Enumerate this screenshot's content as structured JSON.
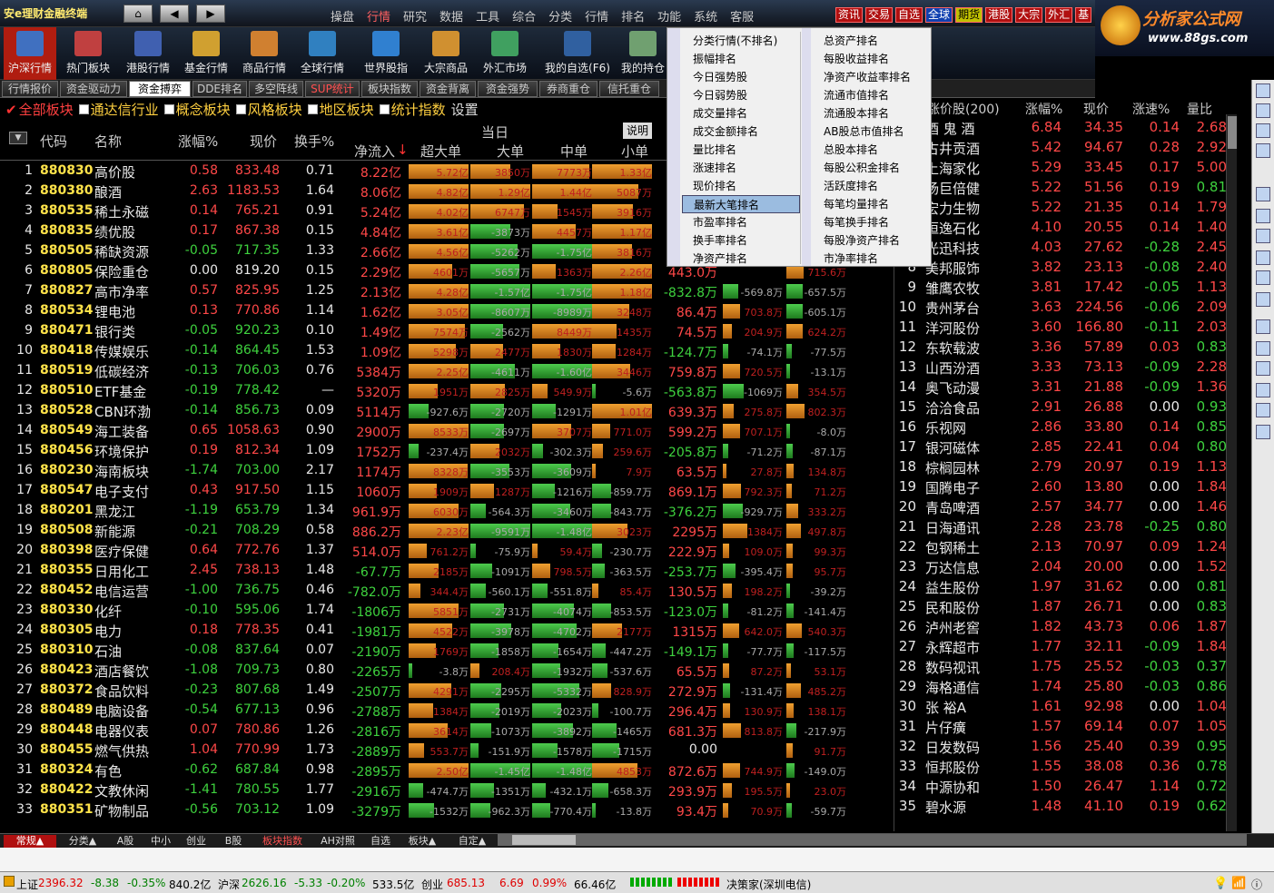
{
  "brand": "安e理财金融终端",
  "top_menu": [
    "操盘",
    "行情",
    "研究",
    "数据",
    "工具",
    "综合",
    "分类",
    "行情",
    "排名",
    "功能",
    "系统",
    "客服"
  ],
  "quick_buttons": [
    "资讯",
    "交易",
    "自选",
    "全球",
    "期货",
    "港股",
    "大宗",
    "外汇",
    "基"
  ],
  "logo": {
    "title": "分析家公式网",
    "url": "www.88gs.com"
  },
  "toolbar": [
    "沪深行情",
    "热门板块",
    "港股行情",
    "基金行情",
    "商品行情",
    "全球行情",
    "世界股指",
    "大宗商品",
    "外汇市场",
    "我的自选(F6)",
    "我的持仓"
  ],
  "tabs": [
    "行情报价",
    "资金驱动力",
    "资金搏弈",
    "DDE排名",
    "多空阵线",
    "SUP统计",
    "板块指数",
    "资金背离",
    "资金强势",
    "券商重仓",
    "信托重仓"
  ],
  "filter": [
    "全部板块",
    "通达信行业",
    "概念板块",
    "风格板块",
    "地区板块",
    "统计指数",
    "设置"
  ],
  "left_head": {
    "code": "代码",
    "name": "名称",
    "pct": "涨幅%",
    "price": "现价",
    "turnover": "换手%",
    "today": "当日",
    "net": "净流入",
    "big": "超大单",
    "large": "大单",
    "mid": "中单",
    "small": "小单",
    "explain": "说明"
  },
  "rows": [
    [
      "1",
      "880830",
      "高价股",
      "0.58",
      "833.48",
      "0.71",
      "8.22亿",
      "5.72亿",
      "3850万",
      "7773万",
      "1.33亿"
    ],
    [
      "2",
      "880380",
      "酿酒",
      "2.63",
      "1183.53",
      "1.64",
      "8.06亿",
      "4.82亿",
      "1.29亿",
      "1.44亿",
      "5087万"
    ],
    [
      "3",
      "880535",
      "稀土永磁",
      "0.14",
      "765.21",
      "0.91",
      "5.24亿",
      "4.02亿",
      "6747万",
      "1545万",
      "3916万"
    ],
    [
      "4",
      "880835",
      "绩优股",
      "0.17",
      "867.38",
      "0.15",
      "4.84亿",
      "3.61亿",
      "-3873万",
      "4457万",
      "1.17亿"
    ],
    [
      "5",
      "880505",
      "稀缺资源",
      "-0.05",
      "717.35",
      "1.33",
      "2.66亿",
      "4.56亿",
      "-5262万",
      "-1.75亿",
      "3816万"
    ],
    [
      "6",
      "880805",
      "保险重仓",
      "0.00",
      "819.20",
      "0.15",
      "2.29亿",
      "4601万",
      "-5657万",
      "1363万",
      "2.26亿"
    ],
    [
      "7",
      "880827",
      "高市净率",
      "0.57",
      "825.95",
      "1.25",
      "2.13亿",
      "4.28亿",
      "-1.57亿",
      "-1.75亿",
      "1.18亿"
    ],
    [
      "8",
      "880534",
      "锂电池",
      "0.13",
      "770.86",
      "1.14",
      "1.62亿",
      "3.05亿",
      "-8607万",
      "-8989万",
      "3248万"
    ],
    [
      "9",
      "880471",
      "银行类",
      "-0.05",
      "920.23",
      "0.10",
      "1.49亿",
      "7574万",
      "-2562万",
      "8449万",
      "1435万"
    ],
    [
      "10",
      "880418",
      "传媒娱乐",
      "-0.14",
      "864.45",
      "1.53",
      "1.09亿",
      "5298万",
      "2477万",
      "1830万",
      "1284万"
    ],
    [
      "11",
      "880519",
      "低碳经济",
      "-0.13",
      "706.03",
      "0.76",
      "5384万",
      "2.25亿",
      "-4611万",
      "-1.60亿",
      "3446万"
    ],
    [
      "12",
      "880510",
      "ETF基金",
      "-0.19",
      "778.42",
      "—",
      "5320万",
      "1951万",
      "2825万",
      "549.9万",
      "-5.6万"
    ],
    [
      "13",
      "880528",
      "CBN环渤",
      "-0.14",
      "856.73",
      "0.09",
      "5114万",
      "-927.6万",
      "-2720万",
      "-1291万",
      "1.01亿"
    ],
    [
      "14",
      "880549",
      "海工装备",
      "0.65",
      "1058.63",
      "0.90",
      "2900万",
      "8533万",
      "-2697万",
      "3707万",
      "771.0万"
    ],
    [
      "15",
      "880456",
      "环境保护",
      "0.19",
      "812.34",
      "1.09",
      "1752万",
      "-237.4万",
      "2032万",
      "-302.3万",
      "259.6万"
    ],
    [
      "16",
      "880230",
      "海南板块",
      "-1.74",
      "703.00",
      "2.17",
      "1174万",
      "8328万",
      "-3553万",
      "-3609万",
      "7.9万"
    ],
    [
      "17",
      "880547",
      "电子支付",
      "0.43",
      "917.50",
      "1.15",
      "1060万",
      "1909万",
      "1287万",
      "-1216万",
      "-859.7万"
    ],
    [
      "18",
      "880201",
      "黑龙江",
      "-1.19",
      "653.79",
      "1.34",
      "961.9万",
      "6030万",
      "-564.3万",
      "-3460万",
      "-843.7万"
    ],
    [
      "19",
      "880508",
      "新能源",
      "-0.21",
      "708.29",
      "0.58",
      "886.2万",
      "2.23亿",
      "-9591万",
      "-1.48亿",
      "3023万"
    ],
    [
      "20",
      "880398",
      "医疗保健",
      "0.64",
      "772.76",
      "1.37",
      "514.0万",
      "761.2万",
      "-75.9万",
      "59.4万",
      "-230.7万"
    ],
    [
      "21",
      "880355",
      "日用化工",
      "2.45",
      "738.13",
      "1.48",
      "-67.7万",
      "2185万",
      "-1091万",
      "798.5万",
      "-363.5万"
    ],
    [
      "22",
      "880452",
      "电信运营",
      "-1.00",
      "736.75",
      "0.46",
      "-782.0万",
      "344.4万",
      "-560.1万",
      "-551.8万",
      "85.4万"
    ],
    [
      "23",
      "880330",
      "化纤",
      "-0.10",
      "595.06",
      "1.74",
      "-1806万",
      "5851万",
      "-2731万",
      "-4074万",
      "-853.5万"
    ],
    [
      "24",
      "880305",
      "电力",
      "0.18",
      "778.35",
      "0.41",
      "-1981万",
      "4522万",
      "-3978万",
      "-4702万",
      "2177万"
    ],
    [
      "25",
      "880310",
      "石油",
      "-0.08",
      "837.64",
      "0.07",
      "-2190万",
      "1769万",
      "-1858万",
      "-1654万",
      "-447.2万"
    ],
    [
      "26",
      "880423",
      "酒店餐饮",
      "-1.08",
      "709.73",
      "0.80",
      "-2265万",
      "-3.8万",
      "208.4万",
      "-1932万",
      "-537.6万"
    ],
    [
      "27",
      "880372",
      "食品饮料",
      "-0.23",
      "807.68",
      "1.49",
      "-2507万",
      "4291万",
      "-2295万",
      "-5332万",
      "828.9万"
    ],
    [
      "28",
      "880489",
      "电脑设备",
      "-0.54",
      "677.13",
      "0.96",
      "-2788万",
      "1384万",
      "-2019万",
      "-2023万",
      "-100.7万"
    ],
    [
      "29",
      "880448",
      "电器仪表",
      "0.07",
      "780.86",
      "1.26",
      "-2816万",
      "3614万",
      "-1073万",
      "-3892万",
      "-1465万"
    ],
    [
      "30",
      "880455",
      "燃气供热",
      "1.04",
      "770.99",
      "1.73",
      "-2889万",
      "553.7万",
      "-151.9万",
      "-1578万",
      "-1715万"
    ],
    [
      "31",
      "880324",
      "有色",
      "-0.62",
      "687.84",
      "0.98",
      "-2895万",
      "2.50亿",
      "-1.45亿",
      "-1.48亿",
      "4853万"
    ],
    [
      "32",
      "880422",
      "文教休闲",
      "-1.41",
      "780.55",
      "1.77",
      "-2916万",
      "-474.7万",
      "-1351万",
      "-432.1万",
      "-658.3万"
    ],
    [
      "33",
      "880351",
      "矿物制品",
      "-0.56",
      "703.12",
      "1.09",
      "-3279万",
      "-1532万",
      "-962.3万",
      "-770.4万",
      "-13.8万"
    ]
  ],
  "extra_cols": [
    [
      "",
      "",
      "",
      "",
      ""
    ],
    [
      "",
      "",
      "",
      "",
      ""
    ],
    [
      "",
      "",
      "",
      "",
      ""
    ],
    [
      "",
      "",
      "",
      "",
      ""
    ],
    [
      "",
      "",
      "",
      "",
      ""
    ],
    [
      "443.0万",
      "",
      "715.6万",
      "",
      ""
    ],
    [
      "-832.8万",
      "-569.8万",
      "-657.5万",
      "",
      ""
    ],
    [
      "86.4万",
      "703.8万",
      "-605.1万",
      "",
      ""
    ],
    [
      "74.5万",
      "204.9万",
      "624.2万",
      "",
      ""
    ],
    [
      "-124.7万",
      "-74.1万",
      "-77.5万",
      "",
      ""
    ],
    [
      "759.8万",
      "720.5万",
      "-13.1万",
      "",
      ""
    ],
    [
      "-563.8万",
      "-1069万",
      "354.5万",
      "",
      ""
    ],
    [
      "639.3万",
      "275.8万",
      "802.3万",
      "",
      ""
    ],
    [
      "599.2万",
      "707.1万",
      "-8.0万",
      "",
      ""
    ],
    [
      "-205.8万",
      "-71.2万",
      "-87.1万",
      "",
      ""
    ],
    [
      "63.5万",
      "27.8万",
      "134.8万",
      "",
      ""
    ],
    [
      "869.1万",
      "792.3万",
      "71.2万",
      "",
      ""
    ],
    [
      "-376.2万",
      "-929.7万",
      "333.2万",
      "",
      ""
    ],
    [
      "2295万",
      "1384万",
      "497.8万",
      "",
      ""
    ],
    [
      "222.9万",
      "109.0万",
      "99.3万",
      "",
      ""
    ],
    [
      "-253.7万",
      "-395.4万",
      "95.7万",
      "",
      ""
    ],
    [
      "130.5万",
      "198.2万",
      "-39.2万",
      "",
      ""
    ],
    [
      "-123.0万",
      "-81.2万",
      "-141.4万",
      "",
      ""
    ],
    [
      "1315万",
      "642.0万",
      "540.3万",
      "",
      ""
    ],
    [
      "-149.1万",
      "-77.7万",
      "-117.5万",
      "",
      ""
    ],
    [
      "65.5万",
      "87.2万",
      "53.1万",
      "",
      ""
    ],
    [
      "272.9万",
      "-131.4万",
      "485.2万",
      "",
      ""
    ],
    [
      "296.4万",
      "130.9万",
      "138.1万",
      "",
      ""
    ],
    [
      "681.3万",
      "813.8万",
      "-217.9万",
      "",
      ""
    ],
    [
      "0.00",
      "",
      "91.7万",
      "",
      ""
    ],
    [
      "872.6万",
      "744.9万",
      "-149.0万",
      "",
      ""
    ],
    [
      "293.9万",
      "195.5万",
      "23.0万",
      "",
      ""
    ],
    [
      "93.4万",
      "70.9万",
      "-59.7万",
      "",
      ""
    ]
  ],
  "dropdown": {
    "col1": [
      "分类行情(不排名)",
      "振幅排名",
      "今日强势股",
      "今日弱势股",
      "成交量排名",
      "成交金额排名",
      "量比排名",
      "涨速排名",
      "现价排名",
      "最新大笔排名",
      "市盈率排名",
      "换手率排名",
      "净资产排名"
    ],
    "col2": [
      "总资产排名",
      "每股收益排名",
      "净资产收益率排名",
      "流通市值排名",
      "流通股本排名",
      "AB股总市值排名",
      "总股本排名",
      "每股公积金排名",
      "活跃度排名",
      "每笔均量排名",
      "每笔换手排名",
      "每股净资产排名",
      "市净率排名"
    ],
    "highlight": "最新大笔排名"
  },
  "right_head": {
    "name": "涨价股(200)",
    "pct": "涨幅%",
    "price": "现价",
    "speed": "涨速%",
    "vr": "量比"
  },
  "right_rows": [
    [
      "1",
      "酒 鬼 酒",
      "6.84",
      "34.35",
      "0.14",
      "2.68"
    ],
    [
      "2",
      "古井贡酒",
      "5.42",
      "94.67",
      "0.28",
      "2.92"
    ],
    [
      "3",
      "上海家化",
      "5.29",
      "33.45",
      "0.17",
      "5.00"
    ],
    [
      "4",
      "扬巨倍健",
      "5.22",
      "51.56",
      "0.19",
      "0.81"
    ],
    [
      "5",
      "宏力生物",
      "5.22",
      "21.35",
      "0.14",
      "1.79"
    ],
    [
      "6",
      "恒逸石化",
      "4.10",
      "20.55",
      "0.14",
      "1.40"
    ],
    [
      "7",
      "光迅科技",
      "4.03",
      "27.62",
      "-0.28",
      "2.45"
    ],
    [
      "8",
      "美邦服饰",
      "3.82",
      "23.13",
      "-0.08",
      "2.40"
    ],
    [
      "9",
      "雏鹰农牧",
      "3.81",
      "17.42",
      "-0.05",
      "1.13"
    ],
    [
      "10",
      "贵州茅台",
      "3.63",
      "224.56",
      "-0.06",
      "2.09"
    ],
    [
      "11",
      "洋河股份",
      "3.60",
      "166.80",
      "-0.11",
      "2.03"
    ],
    [
      "12",
      "东软载波",
      "3.36",
      "57.89",
      "0.03",
      "0.83"
    ],
    [
      "13",
      "山西汾酒",
      "3.33",
      "73.13",
      "-0.09",
      "2.28"
    ],
    [
      "14",
      "奥飞动漫",
      "3.31",
      "21.88",
      "-0.09",
      "1.36"
    ],
    [
      "15",
      "洽洽食品",
      "2.91",
      "26.88",
      "0.00",
      "0.93"
    ],
    [
      "16",
      "乐视网",
      "2.86",
      "33.80",
      "0.14",
      "0.85"
    ],
    [
      "17",
      "银河磁体",
      "2.85",
      "22.41",
      "0.04",
      "0.80"
    ],
    [
      "18",
      "棕榈园林",
      "2.79",
      "20.97",
      "0.19",
      "1.13"
    ],
    [
      "19",
      "国腾电子",
      "2.60",
      "13.80",
      "0.00",
      "1.84"
    ],
    [
      "20",
      "青岛啤酒",
      "2.57",
      "34.77",
      "0.00",
      "1.46"
    ],
    [
      "21",
      "日海通讯",
      "2.28",
      "23.78",
      "-0.25",
      "0.80"
    ],
    [
      "22",
      "包钢稀土",
      "2.13",
      "70.97",
      "0.09",
      "1.24"
    ],
    [
      "23",
      "万达信息",
      "2.04",
      "20.00",
      "0.00",
      "1.52"
    ],
    [
      "24",
      "益生股份",
      "1.97",
      "31.62",
      "0.00",
      "0.81"
    ],
    [
      "25",
      "民和股份",
      "1.87",
      "26.71",
      "0.00",
      "0.83"
    ],
    [
      "26",
      "泸州老窖",
      "1.82",
      "43.73",
      "0.06",
      "1.87"
    ],
    [
      "27",
      "永辉超市",
      "1.77",
      "32.11",
      "-0.09",
      "1.84"
    ],
    [
      "28",
      "数码视讯",
      "1.75",
      "25.52",
      "-0.03",
      "0.37"
    ],
    [
      "29",
      "海格通信",
      "1.74",
      "25.80",
      "-0.03",
      "0.86"
    ],
    [
      "30",
      "张  裕A",
      "1.61",
      "92.98",
      "0.00",
      "1.04"
    ],
    [
      "31",
      "片仔癀",
      "1.57",
      "69.14",
      "0.07",
      "1.05"
    ],
    [
      "32",
      "日发数码",
      "1.56",
      "25.40",
      "0.39",
      "0.95"
    ],
    [
      "33",
      "恒邦股份",
      "1.55",
      "38.08",
      "0.36",
      "0.78"
    ],
    [
      "34",
      "中源协和",
      "1.50",
      "26.47",
      "1.14",
      "0.72"
    ],
    [
      "35",
      "碧水源",
      "1.48",
      "41.10",
      "0.19",
      "0.62"
    ]
  ],
  "bottom_tabs": [
    "常规▲",
    "分类▲",
    "A股",
    "中小",
    "创业",
    "B股",
    "板块指数",
    "AH对照",
    "自选",
    "板块▲",
    "自定▲"
  ],
  "status": {
    "sh_name": "上证",
    "sh_val": "2396.32",
    "sh_chg": "-8.38",
    "sh_pct": "-0.35%",
    "sh_amt": "840.2亿",
    "sz_name": "沪深",
    "sz_val": "2626.16",
    "sz_chg": "-5.33",
    "sz_pct": "-0.20%",
    "sz_amt": "533.5亿",
    "cy_name": "创业",
    "cy_val": "685.13",
    "cy_chg": "6.69",
    "cy_pct": "0.99%",
    "cy_amt": "66.46亿",
    "broker": "决策家(深圳电信)"
  }
}
